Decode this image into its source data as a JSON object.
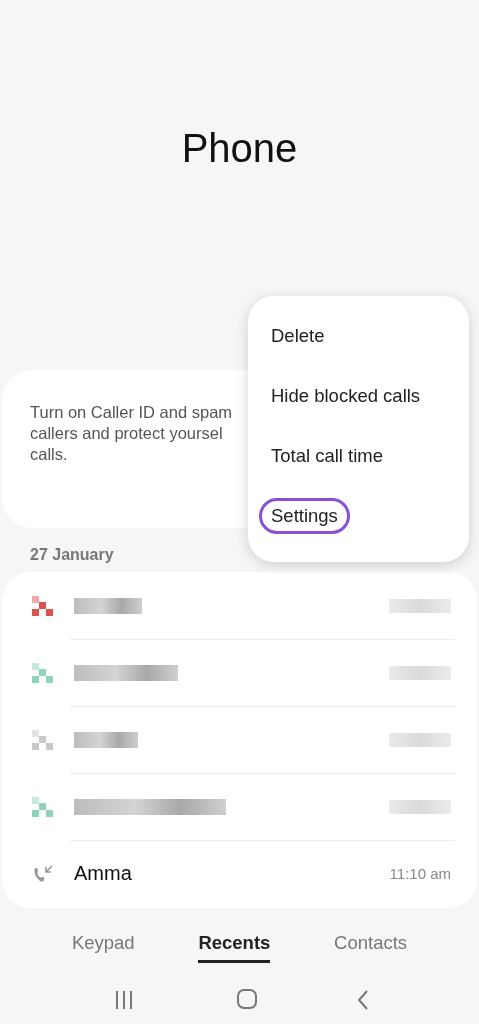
{
  "title": "Phone",
  "caller_id_card": {
    "lines": [
      "Turn on Caller ID and spam",
      "callers and protect yoursel",
      "calls."
    ]
  },
  "menu": {
    "items": [
      {
        "label": "Delete",
        "highlighted": false
      },
      {
        "label": "Hide blocked calls",
        "highlighted": false
      },
      {
        "label": "Total call time",
        "highlighted": false
      },
      {
        "label": "Settings",
        "highlighted": true
      }
    ]
  },
  "date_header": "27 January",
  "calls": [
    {
      "kind": "redacted",
      "color": "#d9534f"
    },
    {
      "kind": "redacted",
      "color": "#8fd3b8"
    },
    {
      "kind": "redacted",
      "color": "#c8c8c8"
    },
    {
      "kind": "redacted",
      "color": "#8fd3b8"
    },
    {
      "kind": "call",
      "name": "Amma",
      "time": "11:10 am"
    }
  ],
  "tabs": [
    {
      "label": "Keypad",
      "selected": false
    },
    {
      "label": "Recents",
      "selected": true
    },
    {
      "label": "Contacts",
      "selected": false
    }
  ]
}
